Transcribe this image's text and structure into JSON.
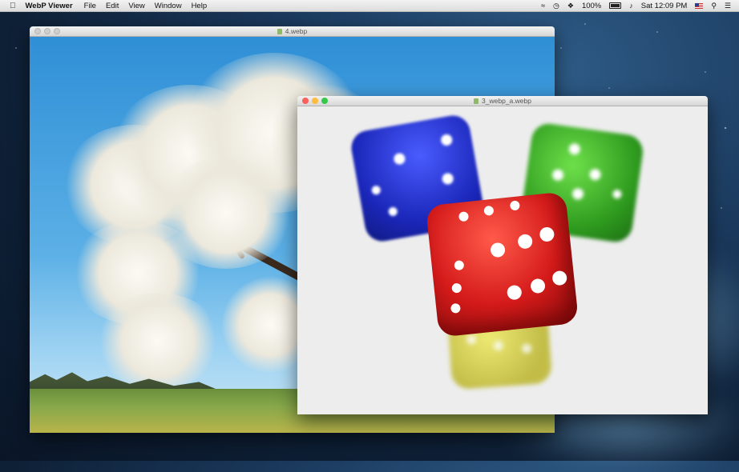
{
  "menubar": {
    "app_name": "WebP Viewer",
    "menus": [
      "File",
      "Edit",
      "View",
      "Window",
      "Help"
    ],
    "status": {
      "battery": "100%",
      "clock": "Sat 12:09 PM"
    }
  },
  "windows": {
    "back": {
      "title": "4.webp"
    },
    "front": {
      "title": "3_webp_a.webp"
    }
  },
  "colors": {
    "accent_red": "#fc605c",
    "accent_yellow": "#fdbc40",
    "accent_green": "#34c84a",
    "die_blue": "#2436c8",
    "die_green": "#3aa82a",
    "die_red": "#d81e1e",
    "die_yellow": "#c8c21a"
  },
  "icons": [
    "apple-icon",
    "wifi-icon",
    "time-machine-icon",
    "bluetooth-icon",
    "battery-icon",
    "volume-icon",
    "flag-icon",
    "search-icon",
    "list-icon"
  ]
}
